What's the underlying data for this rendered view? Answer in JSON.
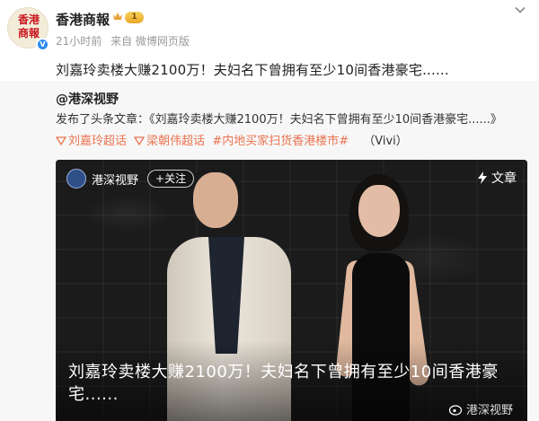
{
  "account": {
    "name": "香港商報",
    "level": "1",
    "avatar_text": [
      "香港",
      "商報"
    ],
    "time": "21小时前",
    "source": "来自 微博网页版"
  },
  "post": {
    "text": "刘嘉玲卖楼大赚2100万！夫妇名下曾拥有至少10间香港豪宅......"
  },
  "repost": {
    "user": "@港深视野",
    "line": "发布了头条文章：《刘嘉玲卖楼大赚2100万！夫妇名下曾拥有至少10间香港豪宅......》",
    "tags": [
      "刘嘉玲超话",
      "梁朝伟超话",
      "#内地买家扫货香港楼市#"
    ],
    "tag_author": "（Vivi）",
    "card": {
      "channel": "港深视野",
      "follow_label": "+关注",
      "badge_label": "文章",
      "title": "刘嘉玲卖楼大赚2100万！夫妇名下曾拥有至少10间香港豪宅......",
      "watermark": "港深视野"
    }
  },
  "colors": {
    "tag": "#eb7350",
    "verified": "#2b8cf3",
    "repost_bg": "#f7f7f7"
  },
  "icons": [
    "verified-icon",
    "crown-icon",
    "chevron-down-icon",
    "supertopic-icon",
    "bolt-icon",
    "weibo-icon"
  ]
}
